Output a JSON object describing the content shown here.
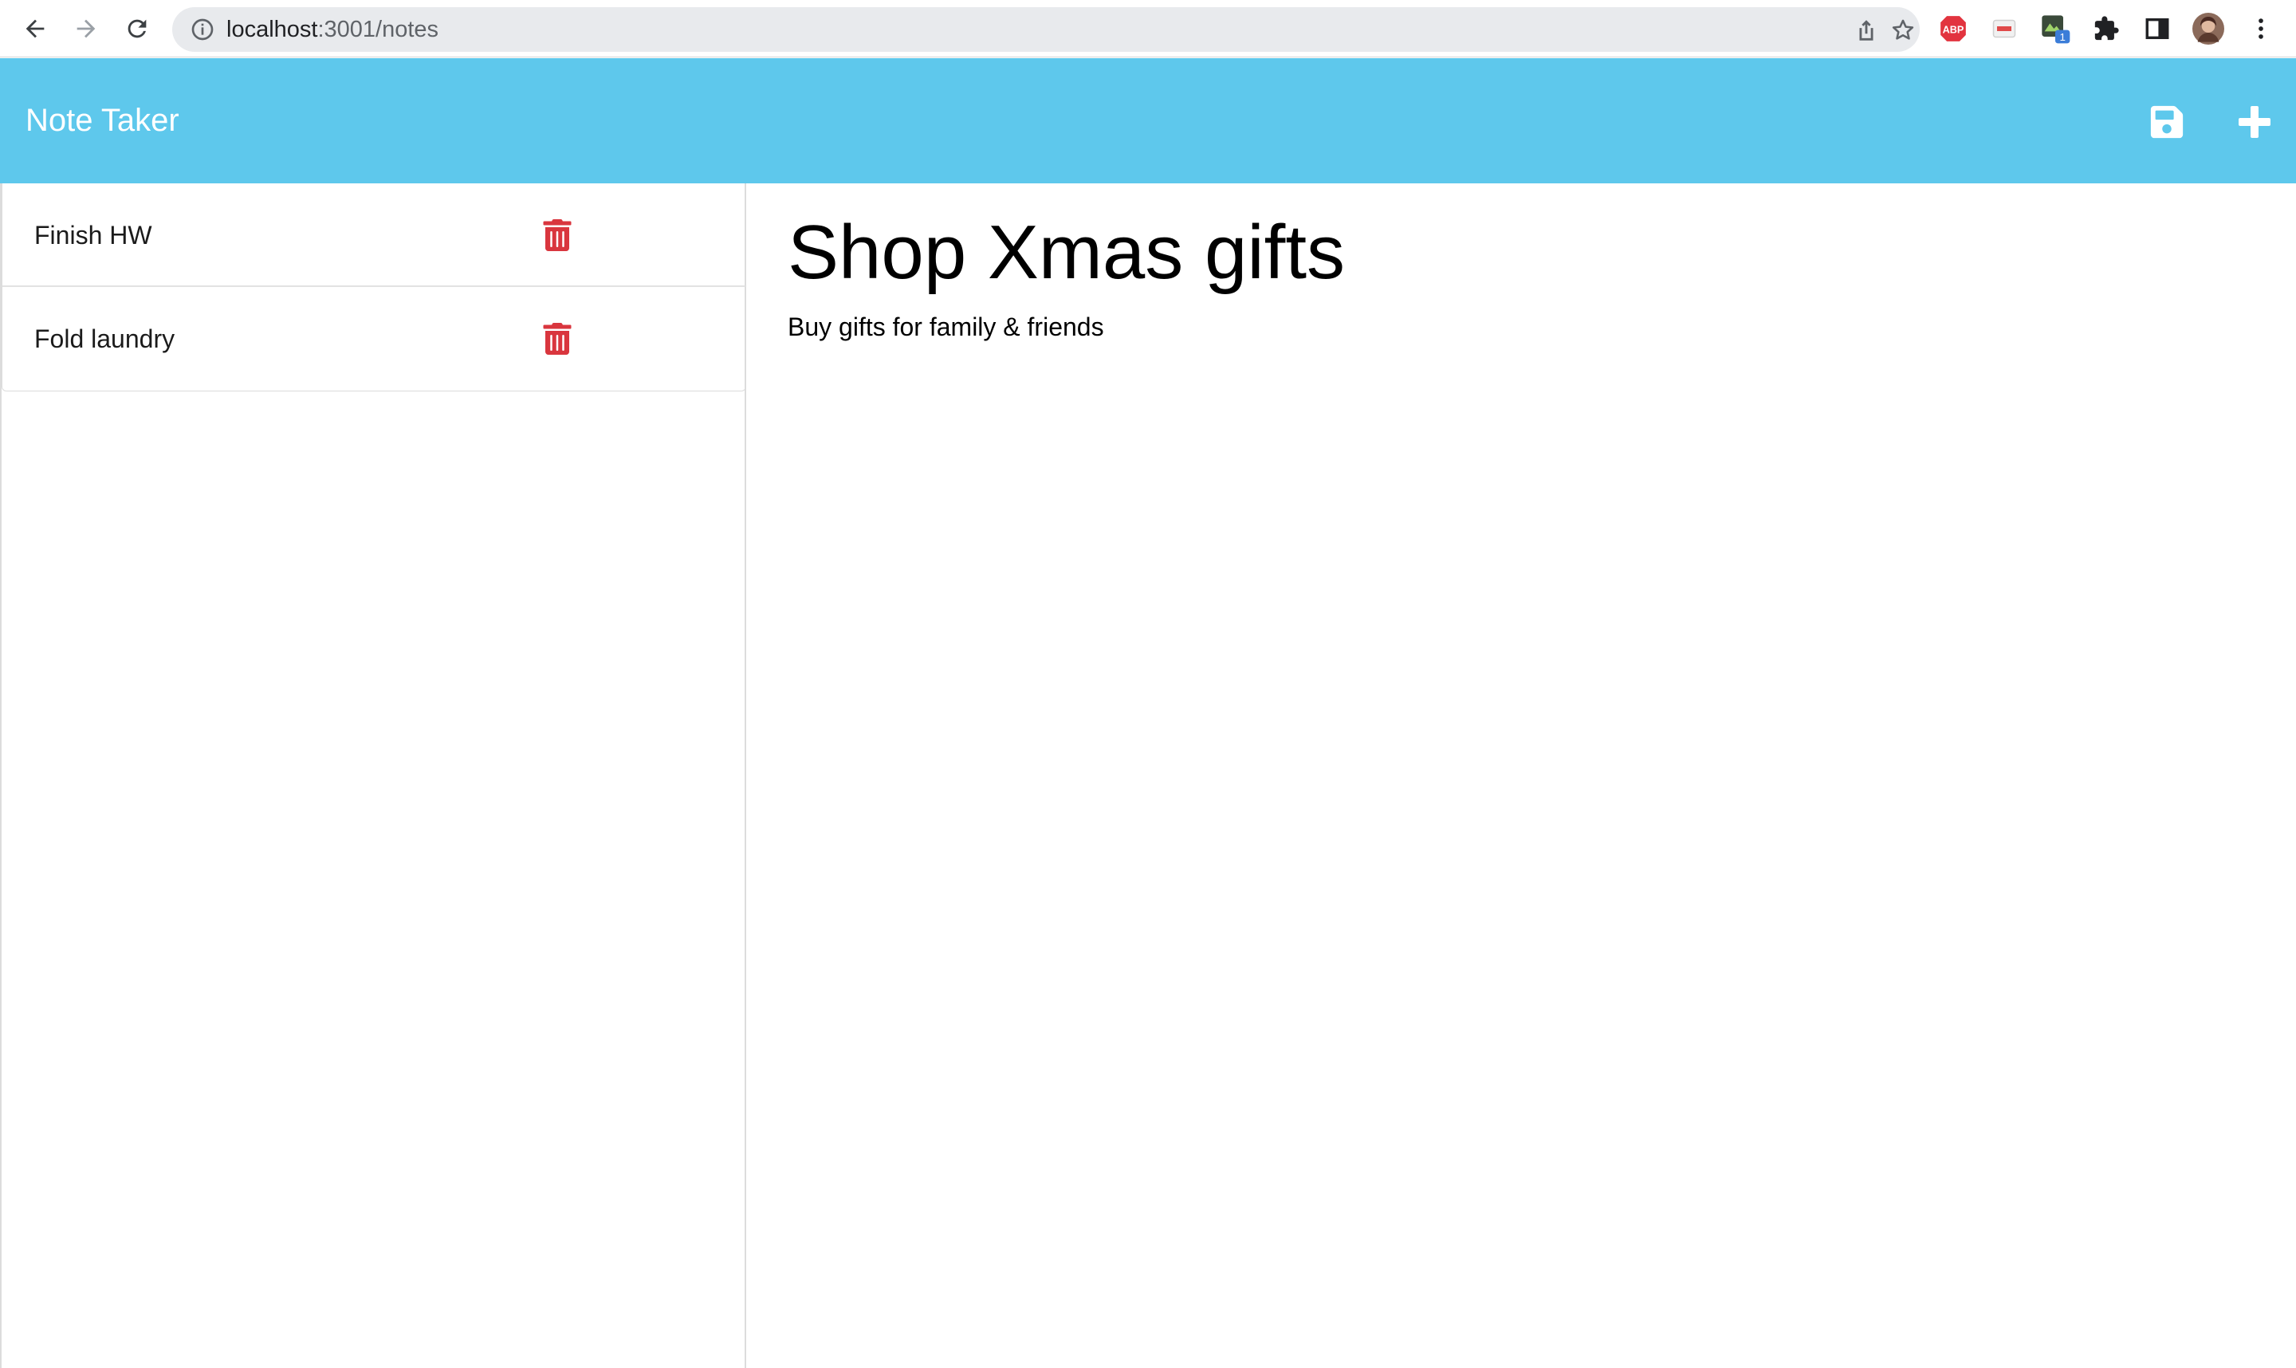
{
  "browser": {
    "url_host": "localhost",
    "url_path": ":3001/notes",
    "extensions": [
      "adblock-plus-icon",
      "pdf-extension-icon",
      "extension-badge-icon",
      "puzzle-icon",
      "side-panel-icon",
      "profile-avatar"
    ],
    "extension_badge": "1",
    "abp_label": "ABP"
  },
  "header": {
    "title": "Note Taker",
    "background_color": "#5ec8ec"
  },
  "notes": [
    {
      "title": "Finish HW"
    },
    {
      "title": "Fold laundry"
    }
  ],
  "active_note": {
    "title": "Shop Xmas gifts",
    "text": "Buy gifts for family & friends"
  },
  "colors": {
    "trash": "#d9363e",
    "header_text": "#ffffff"
  }
}
